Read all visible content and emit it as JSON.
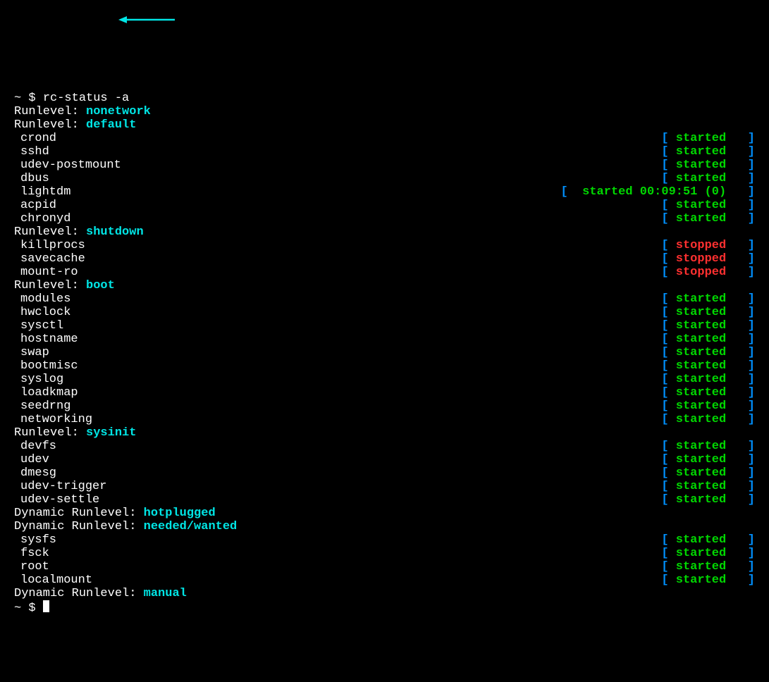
{
  "prompt1": "~ $ ",
  "command": "rc-status -a",
  "prompt2": "~ $ ",
  "runlevel_label": "Runlevel: ",
  "dynamic_label": "Dynamic Runlevel: ",
  "sections": [
    {
      "type": "rl",
      "name": "nonetwork",
      "services": []
    },
    {
      "type": "rl",
      "name": "default",
      "services": [
        {
          "name": "crond",
          "status": "started"
        },
        {
          "name": "sshd",
          "status": "started"
        },
        {
          "name": "udev-postmount",
          "status": "started"
        },
        {
          "name": "dbus",
          "status": "started"
        },
        {
          "name": "lightdm",
          "status": "started",
          "extra": "00:09:51 (0)"
        },
        {
          "name": "acpid",
          "status": "started"
        },
        {
          "name": "chronyd",
          "status": "started"
        }
      ]
    },
    {
      "type": "rl",
      "name": "shutdown",
      "services": [
        {
          "name": "killprocs",
          "status": "stopped"
        },
        {
          "name": "savecache",
          "status": "stopped"
        },
        {
          "name": "mount-ro",
          "status": "stopped"
        }
      ]
    },
    {
      "type": "rl",
      "name": "boot",
      "services": [
        {
          "name": "modules",
          "status": "started"
        },
        {
          "name": "hwclock",
          "status": "started"
        },
        {
          "name": "sysctl",
          "status": "started"
        },
        {
          "name": "hostname",
          "status": "started"
        },
        {
          "name": "swap",
          "status": "started"
        },
        {
          "name": "bootmisc",
          "status": "started"
        },
        {
          "name": "syslog",
          "status": "started"
        },
        {
          "name": "loadkmap",
          "status": "started"
        },
        {
          "name": "seedrng",
          "status": "started"
        },
        {
          "name": "networking",
          "status": "started"
        }
      ]
    },
    {
      "type": "rl",
      "name": "sysinit",
      "services": [
        {
          "name": "devfs",
          "status": "started"
        },
        {
          "name": "udev",
          "status": "started"
        },
        {
          "name": "dmesg",
          "status": "started"
        },
        {
          "name": "udev-trigger",
          "status": "started"
        },
        {
          "name": "udev-settle",
          "status": "started"
        }
      ]
    },
    {
      "type": "dyn",
      "name": "hotplugged",
      "services": []
    },
    {
      "type": "dyn",
      "name": "needed/wanted",
      "services": [
        {
          "name": "sysfs",
          "status": "started"
        },
        {
          "name": "fsck",
          "status": "started"
        },
        {
          "name": "root",
          "status": "started"
        },
        {
          "name": "localmount",
          "status": "started"
        }
      ]
    },
    {
      "type": "dyn",
      "name": "manual",
      "services": []
    }
  ]
}
